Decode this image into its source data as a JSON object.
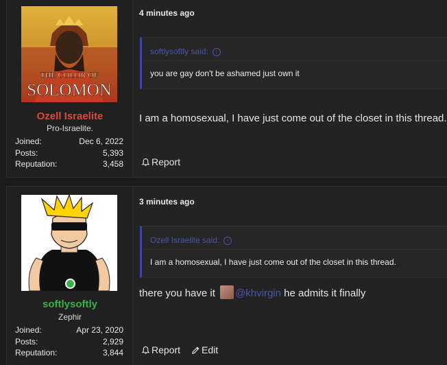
{
  "posts": [
    {
      "user": {
        "name": "Ozell Israelite",
        "name_color": "#e0473b",
        "title": "Pro-Israelite.",
        "avatar_text": [
          "THE COLOR OF",
          "SOLOMON"
        ],
        "stats": [
          {
            "label": "Joined:",
            "value": "Dec 6, 2022"
          },
          {
            "label": "Posts:",
            "value": "5,393"
          },
          {
            "label": "Reputation:",
            "value": "3,458"
          }
        ]
      },
      "date": "4 minutes ago",
      "quote": {
        "author": "softlysoftly said:",
        "text": "you are gay don't be ashamed just own it"
      },
      "body": "I am a homosexual, I have just come out of the closet in this thread.",
      "actions": {
        "report": "Report"
      }
    },
    {
      "user": {
        "name": "softlysoftly",
        "name_color": "#3bb04a",
        "title": "Zephir",
        "stats": [
          {
            "label": "Joined:",
            "value": "Apr 23, 2020"
          },
          {
            "label": "Posts:",
            "value": "2,929"
          },
          {
            "label": "Reputation:",
            "value": "3,844"
          }
        ]
      },
      "date": "3 minutes ago",
      "quote": {
        "author": "Ozell Israelite said:",
        "text": "I am a homosexual, I have just come out of the closet in this thread."
      },
      "body_before": "there you have it",
      "mention": "@khvirgin",
      "body_after": "he admits it finally",
      "actions": {
        "report": "Report",
        "edit": "Edit"
      }
    }
  ],
  "icons": {
    "report": "bell-icon",
    "edit": "pencil-icon",
    "quote_jump": "arrow-up-circle-icon",
    "online": "online-status-icon"
  }
}
